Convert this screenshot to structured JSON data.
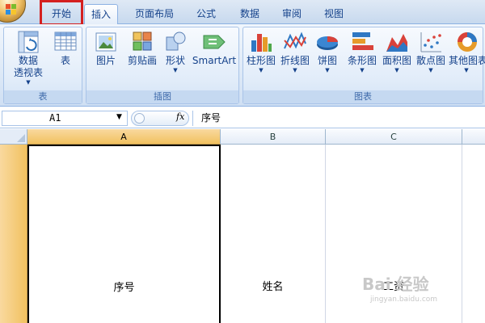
{
  "tabs": [
    {
      "label": "开始",
      "active": false
    },
    {
      "label": "插入",
      "active": true
    },
    {
      "label": "页面布局",
      "active": false
    },
    {
      "label": "公式",
      "active": false
    },
    {
      "label": "数据",
      "active": false
    },
    {
      "label": "审阅",
      "active": false
    },
    {
      "label": "视图",
      "active": false
    }
  ],
  "ribbon": {
    "groups": {
      "tables": {
        "label": "表",
        "buttons": [
          {
            "label": "数据",
            "label2": "透视表",
            "icon": "pivot-table-icon"
          },
          {
            "label": "表",
            "icon": "table-icon"
          }
        ]
      },
      "illustrations": {
        "label": "插图",
        "buttons": [
          {
            "label": "图片",
            "icon": "picture-icon"
          },
          {
            "label": "剪贴画",
            "icon": "clip-art-icon"
          },
          {
            "label": "形状",
            "icon": "shapes-icon"
          },
          {
            "label": "SmartArt",
            "icon": "smartart-icon"
          }
        ]
      },
      "charts": {
        "label": "图表",
        "buttons": [
          {
            "label": "柱形图",
            "icon": "column-chart-icon"
          },
          {
            "label": "折线图",
            "icon": "line-chart-icon"
          },
          {
            "label": "饼图",
            "icon": "pie-chart-icon"
          },
          {
            "label": "条形图",
            "icon": "bar-chart-icon"
          },
          {
            "label": "面积图",
            "icon": "area-chart-icon"
          },
          {
            "label": "散点图",
            "icon": "scatter-chart-icon"
          },
          {
            "label": "其他图表",
            "icon": "other-charts-icon"
          }
        ]
      }
    }
  },
  "formula_bar": {
    "name_box": "A1",
    "fx": "fx",
    "content": "序号"
  },
  "sheet": {
    "columns": [
      "A",
      "B",
      "C"
    ],
    "selected_column": "A",
    "row1": [
      "序号",
      "姓名",
      "工资"
    ]
  },
  "watermark": {
    "text": "Bai 经验",
    "sub": "jingyan.baidu.com"
  },
  "colors": {
    "highlight_box": "#d42020",
    "selected_header": "#f1c15f",
    "ribbon_text": "#15428b"
  }
}
